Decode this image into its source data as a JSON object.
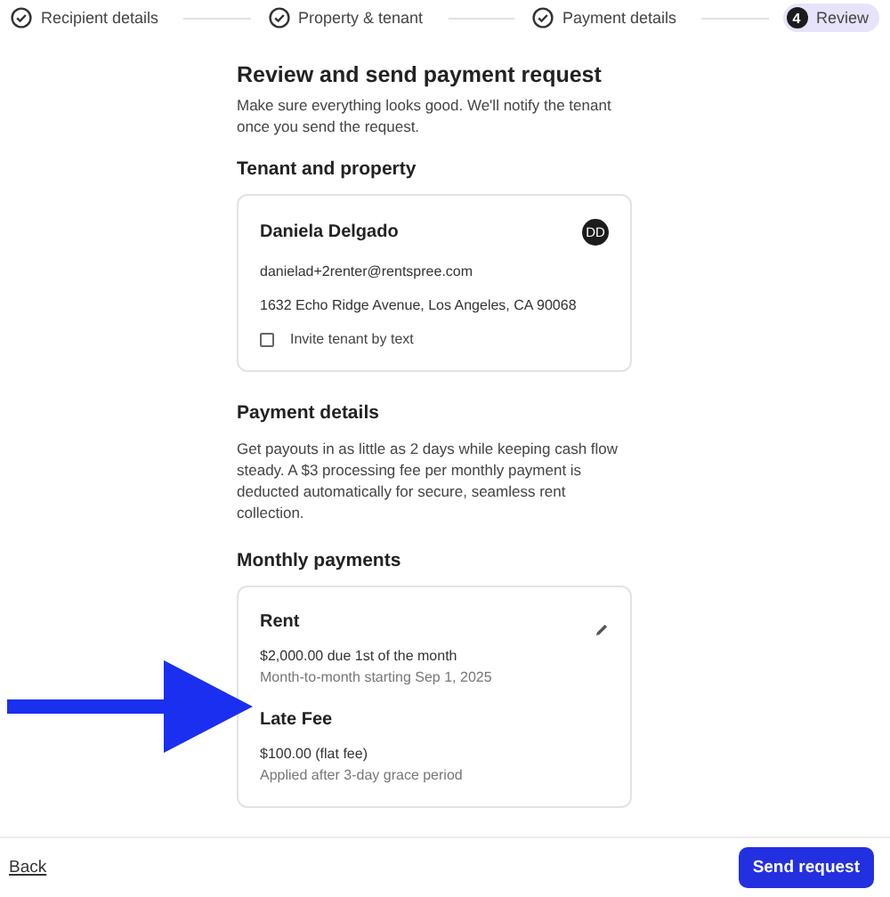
{
  "steps": [
    {
      "label": "Recipient details",
      "completed": true,
      "selected": false
    },
    {
      "label": "Property & tenant",
      "completed": true,
      "selected": false
    },
    {
      "label": "Payment details",
      "completed": true,
      "selected": false
    },
    {
      "label": "Review",
      "completed": false,
      "number": "4",
      "selected": true
    }
  ],
  "title": "Review and send payment request",
  "intro": "Make sure everything looks good. We'll notify the tenant once you send the request.",
  "tenant_section": {
    "heading": "Tenant and property",
    "name": "Daniela Delgado",
    "initials": "DD",
    "email": "danielad+2renter@rentspree.com",
    "address": "1632 Echo Ridge Avenue, Los Angeles, CA 90068",
    "invite": {
      "label": "Invite tenant by text",
      "checked": false
    }
  },
  "payment_section": {
    "heading": "Payment details",
    "text": "Get payouts in as little as 2 days while keeping cash flow steady. A $3 processing fee per monthly payment is deducted automatically for secure, seamless rent collection."
  },
  "monthly_section": {
    "heading": "Monthly payments",
    "items": [
      {
        "title": "Rent",
        "amount": "$2,000.00 due 1st of the month",
        "note": "Month-to-month starting Sep 1, 2025",
        "editable": true
      },
      {
        "title": "Late Fee",
        "amount": "$100.00 (flat fee)",
        "note": "Applied after 3-day grace period",
        "editable": false
      }
    ]
  },
  "annotation": {
    "kind": "arrow",
    "color": "#1a2ff0"
  },
  "footer": {
    "back": "Back",
    "submit": "Send request"
  }
}
